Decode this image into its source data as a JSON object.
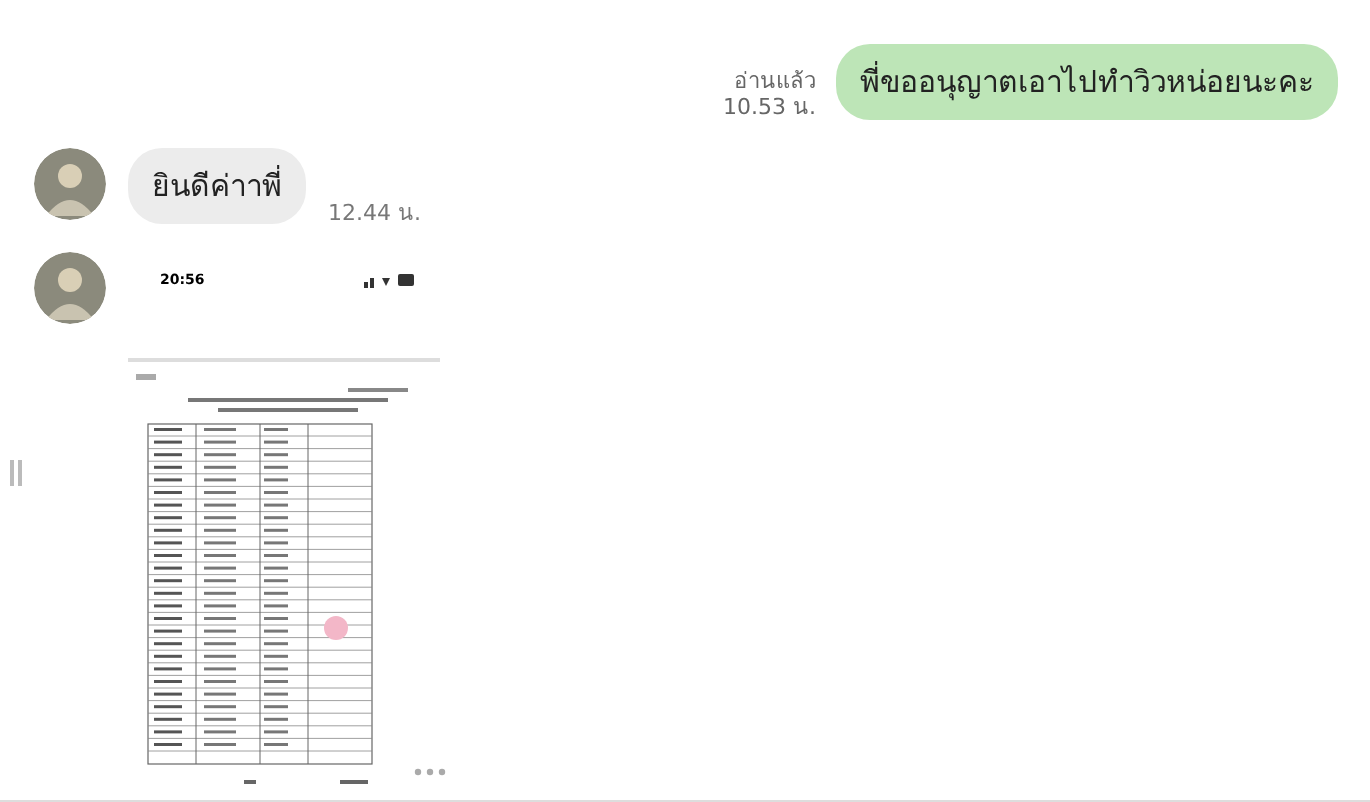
{
  "messages": [
    {
      "kind": "text",
      "outgoing": true,
      "text": "พี่ขออนุญาตเอาไปทำวิวหน่อยนะคะ",
      "read_label": "อ่านแล้ว",
      "time": "10.53 น."
    },
    {
      "kind": "text",
      "outgoing": false,
      "text": "ยินดีค่าาพี่",
      "time": "12.44 น."
    },
    {
      "kind": "image",
      "outgoing": false,
      "phone_time": "20:56"
    }
  ]
}
